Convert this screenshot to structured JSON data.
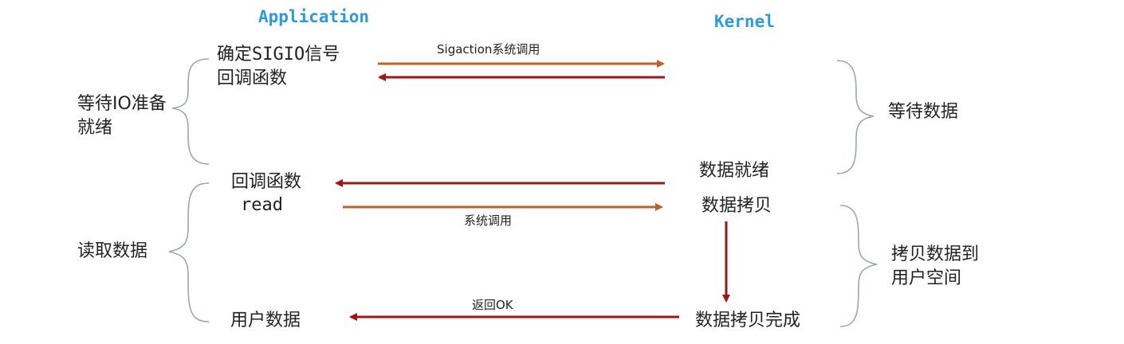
{
  "headers": {
    "application": "Application",
    "kernel": "Kernel"
  },
  "app": {
    "register_line1_prefix": "确定",
    "register_line1_code": "SIGIO",
    "register_line1_suffix": "信号",
    "register_line2": "回调函数",
    "callback": "回调函数",
    "read": "read",
    "user_data": "用户数据"
  },
  "kernel": {
    "data_ready": "数据就绪",
    "data_copy": "数据拷贝",
    "copy_done": "数据拷贝完成"
  },
  "arrows": {
    "sigaction": "Sigaction系统调用",
    "syscall": "系统调用",
    "return_ok": "返回OK"
  },
  "phases": {
    "wait_io_line1": "等待IO准备",
    "wait_io_line2": "就绪",
    "read_data": "读取数据",
    "wait_data": "等待数据",
    "copy_line1": "拷贝数据到",
    "copy_line2": "用户空间"
  },
  "colors": {
    "syscall_arrow": "#c0602a",
    "return_arrow": "#a01616",
    "header_text": "#2f9bd6",
    "brace": "#9aa7b6"
  }
}
